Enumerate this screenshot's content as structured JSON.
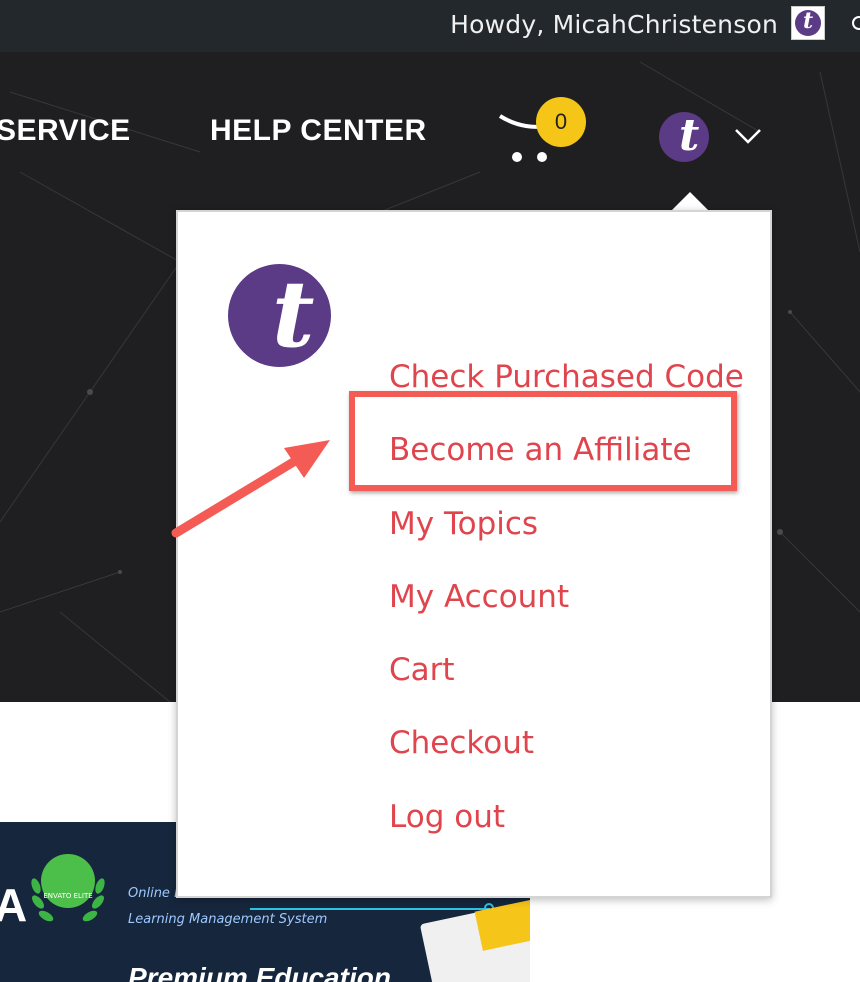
{
  "admin_bar": {
    "greeting": "Howdy, MicahChristenson",
    "avatar_letter": "t"
  },
  "nav": {
    "items": [
      "SERVICE",
      "HELP CENTER"
    ],
    "cart_count": "0",
    "avatar_letter": "t",
    "chevron": "chevron-down-icon"
  },
  "dropdown": {
    "avatar_letter": "t",
    "menu": [
      "Check Purchased Code",
      "Become an Affiliate",
      "My Topics",
      "My Account",
      "Cart",
      "Checkout",
      "Log out"
    ],
    "highlighted": "Become an Affiliate"
  },
  "banner": {
    "big_letter": "A",
    "badge_text": "ENVATO ELITE",
    "line1": "Online E",
    "line2": "Learning Management System",
    "title": "Premium Education"
  },
  "colors": {
    "menu_text": "#e0454d",
    "highlight": "#f45b55",
    "cart_badge": "#f5c518",
    "avatar": "#5b3a86",
    "hero_bg": "#1f1f21",
    "admin_bar": "#23282d"
  }
}
